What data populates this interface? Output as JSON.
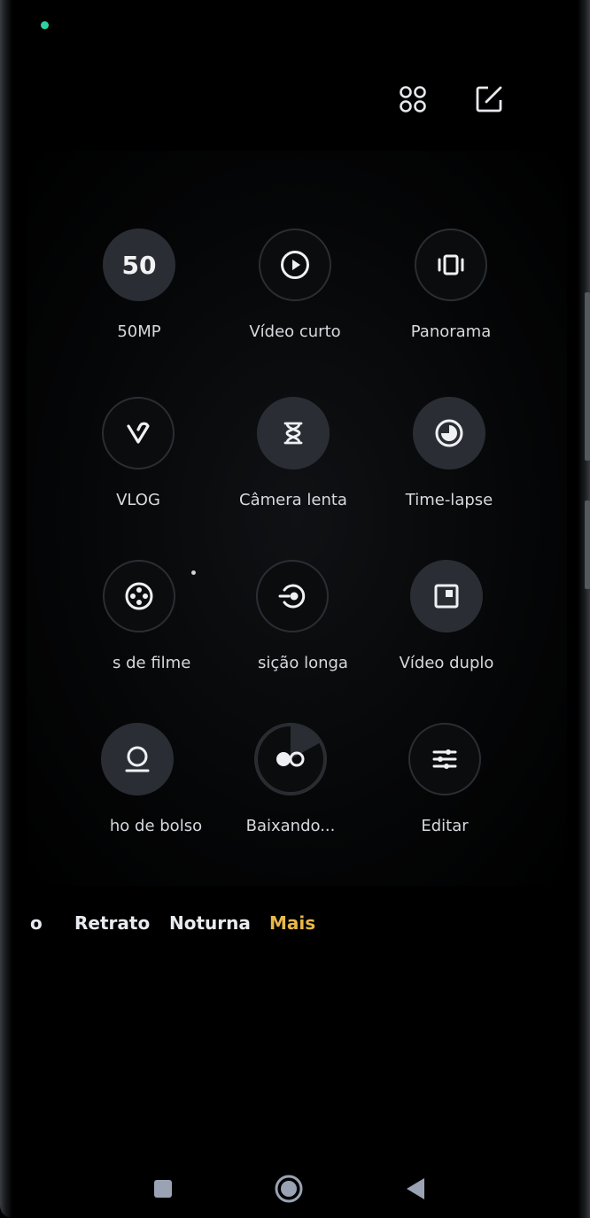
{
  "header": {
    "grid_icon": "grid-icon",
    "edit_icon": "edit-icon"
  },
  "modes": [
    {
      "label": "50MP",
      "icon": "50mp-icon",
      "text": "50"
    },
    {
      "label": "Vídeo curto",
      "icon": "play-circle-icon"
    },
    {
      "label": "Panorama",
      "icon": "panorama-icon"
    },
    {
      "label": "VLOG",
      "icon": "vlog-icon"
    },
    {
      "label": "Câmera lenta",
      "icon": "hourglass-icon"
    },
    {
      "label": "Time-lapse",
      "icon": "timer-icon"
    },
    {
      "label": "s de filme",
      "icon": "film-reel-icon"
    },
    {
      "label": "sição longa",
      "icon": "long-exposure-icon"
    },
    {
      "label": "Vídeo duplo",
      "icon": "dual-video-icon"
    },
    {
      "label": "ho de bolso",
      "icon": "pocket-mode-icon"
    },
    {
      "label": "Baixando...",
      "icon": "download-progress-icon"
    },
    {
      "label": "Editar",
      "icon": "sliders-icon"
    }
  ],
  "tabs": [
    "o",
    "Retrato",
    "Noturna",
    "Mais"
  ],
  "active_tab": "Mais",
  "colors": {
    "active_tab": "#e8b84a",
    "status_dot": "#2ed1a3"
  },
  "nav": {
    "recents": "square-icon",
    "home": "circle-icon",
    "back": "triangle-icon"
  }
}
